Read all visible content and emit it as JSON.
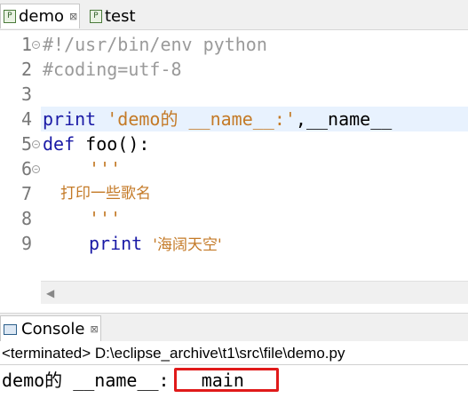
{
  "tabs": [
    {
      "icon": "python-file-icon",
      "label": "demo",
      "close": "⊠"
    },
    {
      "icon": "python-file-icon",
      "label": "test"
    }
  ],
  "editor": {
    "lines": [
      {
        "n": "1",
        "text": "#!/usr/bin/env python"
      },
      {
        "n": "2",
        "text": "#coding=utf-8"
      },
      {
        "n": "3",
        "text": ""
      },
      {
        "n": "4",
        "kw": "print",
        "str": "'demo的 __name__:'",
        "rest": ",__name__"
      },
      {
        "n": "5",
        "kw": "def",
        "rest": " foo():"
      },
      {
        "n": "6",
        "str": "'''"
      },
      {
        "n": "7",
        "str": "打印一些歌名"
      },
      {
        "n": "8",
        "str": "'''"
      },
      {
        "n": "9",
        "kw": "print",
        "str": "'海阔天空'"
      }
    ]
  },
  "console": {
    "tab_label": "Console",
    "tab_close": "⊠",
    "terminated": "<terminated> D:\\eclipse_archive\\t1\\src\\file\\demo.py",
    "output_prefix": "demo的 __name__:",
    "output_value": "__main__"
  },
  "colors": {
    "keyword": "#1a1aa6",
    "string": "#c47a27",
    "comment": "#9a9a9a",
    "highlight": "#e8f2fe",
    "redbox": "#e01a1a"
  }
}
